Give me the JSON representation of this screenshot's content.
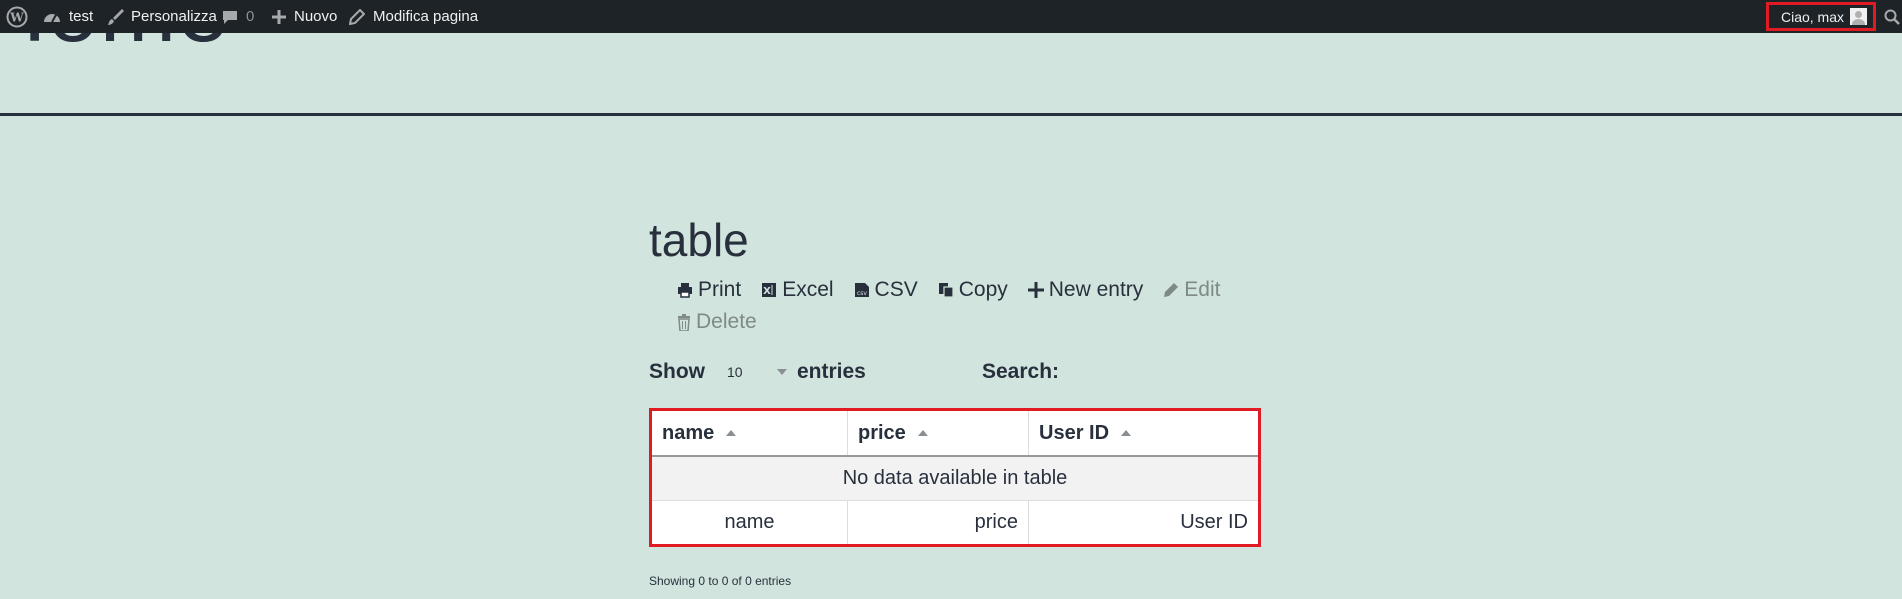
{
  "adminbar": {
    "site_name": "test",
    "customize": "Personalizza",
    "comments_count": "0",
    "new": "Nuovo",
    "edit_page": "Modifica pagina",
    "greeting": "Ciao, max"
  },
  "header": {
    "site_title": "Home"
  },
  "page": {
    "title": "table",
    "buttons": [
      "Print",
      "Excel",
      "CSV",
      "Copy",
      "New entry",
      "Edit",
      "Delete"
    ],
    "show_label": "Show",
    "length_value": "10",
    "entries_label": "entries",
    "search_label": "Search:",
    "columns": [
      "name",
      "price",
      "User ID"
    ],
    "empty_message": "No data available in table",
    "footer_columns": [
      "name",
      "price",
      "User ID"
    ],
    "info": "Showing 0 to 0 of 0 entries"
  },
  "colors": {
    "background": "#d1e4dd",
    "text": "#28303d",
    "adminbar": "#1d2327",
    "highlight": "#e01b24"
  }
}
